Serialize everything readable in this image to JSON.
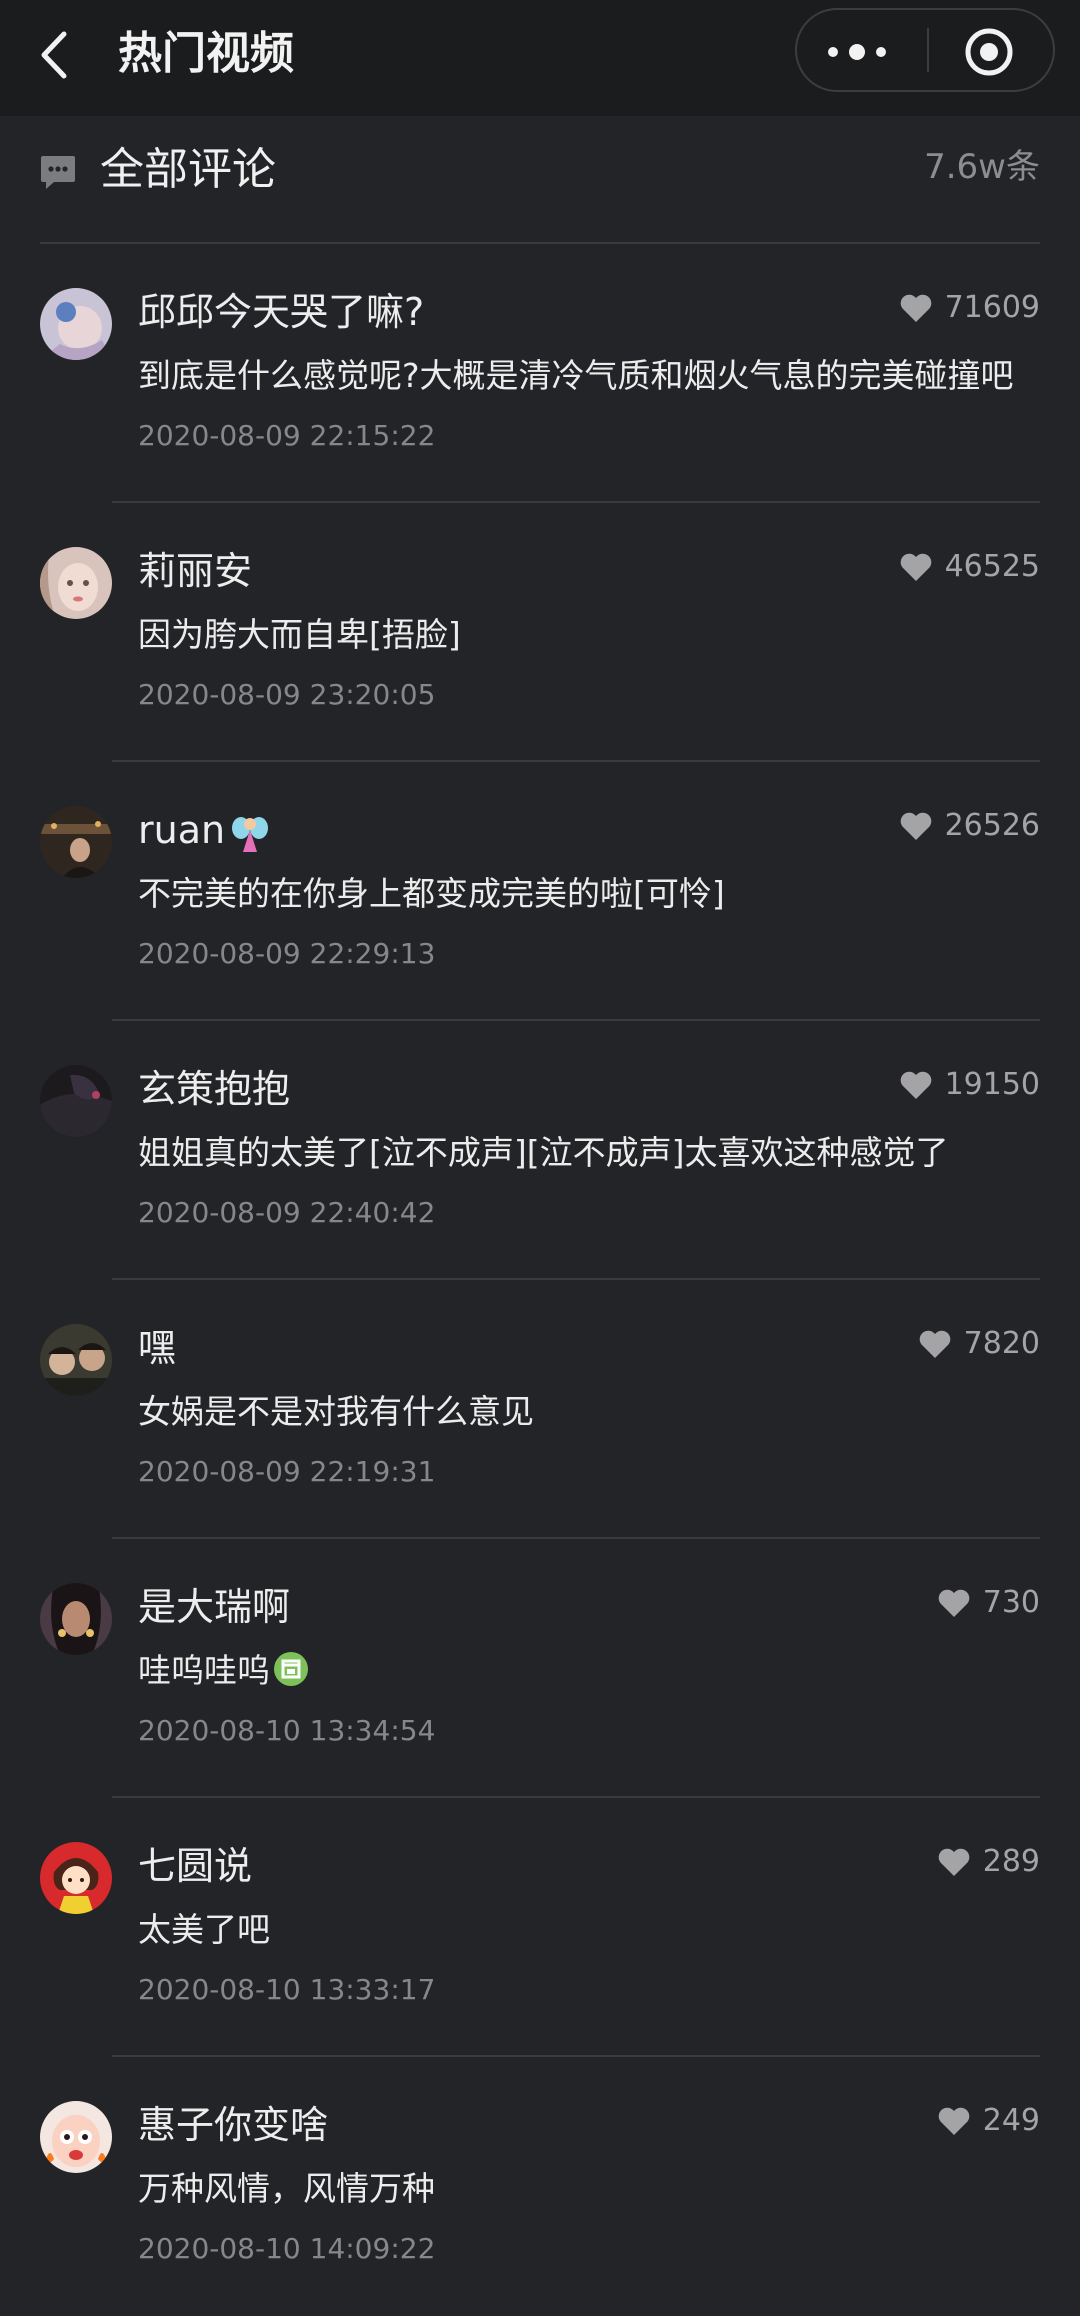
{
  "navbar": {
    "title": "热门视频",
    "back_icon": "back-arrow-icon",
    "more_icon": "more-dots-icon",
    "close_icon": "target-circle-icon"
  },
  "section": {
    "title": "全部评论",
    "count": "7.6w条",
    "icon": "comment-bubble-icon"
  },
  "colors": {
    "background": "#232427",
    "navbar": "#1b1c1e",
    "divider": "#3a3b3e",
    "secondary_text": "#87878a"
  },
  "comments": [
    {
      "user": "邱邱今天哭了嘛?",
      "likes": "71609",
      "content": "到底是什么感觉呢?大概是清冷气质和烟火气息的完美碰撞吧",
      "time": "2020-08-09 22:15:22"
    },
    {
      "user": "莉丽安",
      "likes": "46525",
      "content": "因为胯大而自卑[捂脸]",
      "time": "2020-08-09 23:20:05"
    },
    {
      "user": "ruan",
      "likes": "26526",
      "content": "不完美的在你身上都变成完美的啦[可怜]",
      "time": "2020-08-09 22:29:13"
    },
    {
      "user": "玄策抱抱",
      "likes": "19150",
      "content": "姐姐真的太美了[泣不成声][泣不成声]太喜欢这种感觉了",
      "time": "2020-08-09 22:40:42"
    },
    {
      "user": "嘿",
      "likes": "7820",
      "content": "女娲是不是对我有什么意见",
      "time": "2020-08-09 22:19:31"
    },
    {
      "user": "是大瑞啊",
      "likes": "730",
      "content": "哇呜哇呜",
      "time": "2020-08-10 13:34:54"
    },
    {
      "user": "七圆说",
      "likes": "289",
      "content": "太美了吧",
      "time": "2020-08-10 13:33:17"
    },
    {
      "user": "惠子你变啥",
      "likes": "249",
      "content": "万种风情，风情万种",
      "time": "2020-08-10 14:09:22"
    }
  ]
}
